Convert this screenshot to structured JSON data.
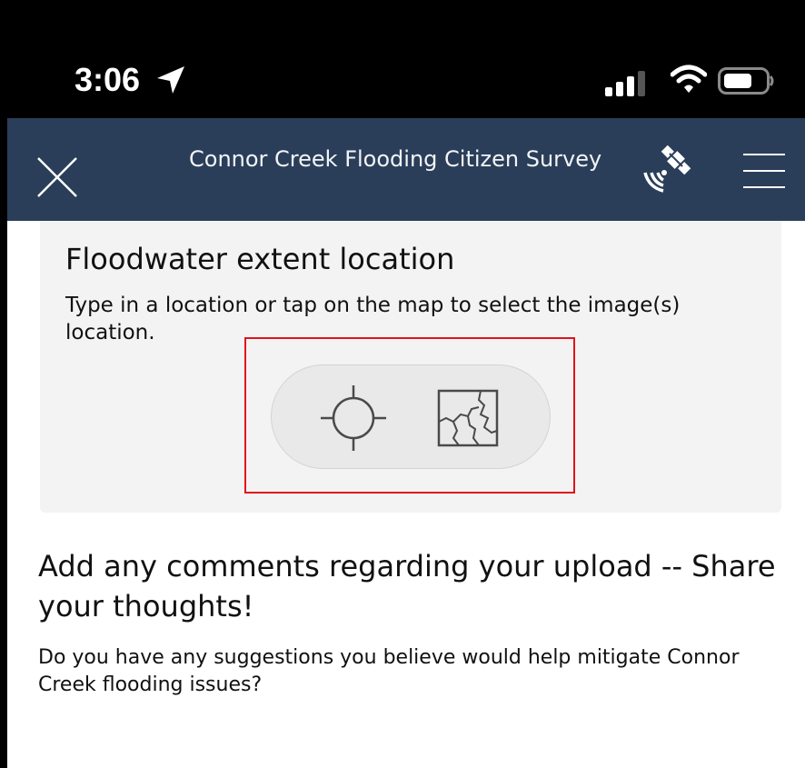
{
  "status_bar": {
    "time": "3:06",
    "icons": [
      "location-arrow-icon",
      "cellular-signal-icon",
      "wifi-icon",
      "battery-icon"
    ]
  },
  "header": {
    "title": "Connor Creek Flooding Citizen Survey",
    "close_icon": "close-icon",
    "gps_icon": "gps-satellite-icon",
    "menu_icon": "hamburger-menu-icon",
    "background_color": "#2b3e59"
  },
  "question1": {
    "title": "Floodwater extent location",
    "hint": "Type in a location or tap on the map to select the image(s) location.",
    "buttons": [
      "crosshair-locate-icon",
      "map-icon"
    ],
    "highlight_color": "#e0121a"
  },
  "question2": {
    "title": "Add any comments regarding your upload -- Share your thoughts!",
    "hint": "Do you have any suggestions you believe would help mitigate Connor Creek flooding issues?"
  }
}
